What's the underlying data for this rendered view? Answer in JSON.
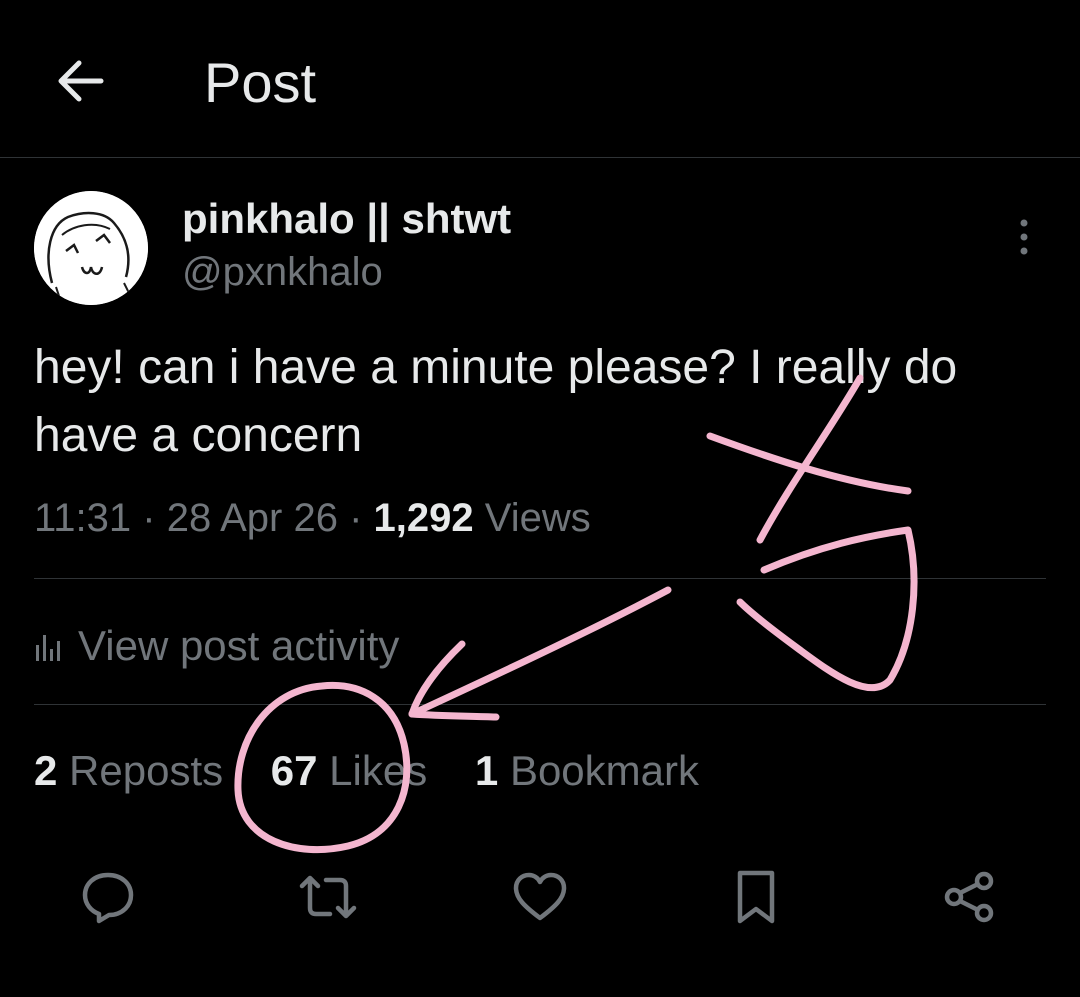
{
  "header": {
    "title": "Post"
  },
  "author": {
    "display_name": "pinkhalo || shtwt",
    "handle": "@pxnkhalo"
  },
  "post": {
    "text": "hey! can i have a minute please? I really do have a concern",
    "time": "11:31",
    "date": "28 Apr 26",
    "views_count": "1,292",
    "views_label": "Views"
  },
  "activity": {
    "label": "View post activity"
  },
  "stats": {
    "reposts_count": "2",
    "reposts_label": "Reposts",
    "likes_count": "67",
    "likes_label": "Likes",
    "bookmarks_count": "1",
    "bookmarks_label": "Bookmark"
  },
  "icons": {
    "back": "arrow-left-icon",
    "more": "more-vertical-icon",
    "activity": "bar-chart-icon",
    "reply": "reply-icon",
    "repost": "repost-icon",
    "like": "heart-icon",
    "bookmark": "bookmark-icon",
    "share": "share-icon"
  },
  "colors": {
    "background": "#000000",
    "primary_text": "#e7e9ea",
    "secondary_text": "#71767b",
    "divider": "#2f3336",
    "annotation": "#f4b6cf"
  }
}
